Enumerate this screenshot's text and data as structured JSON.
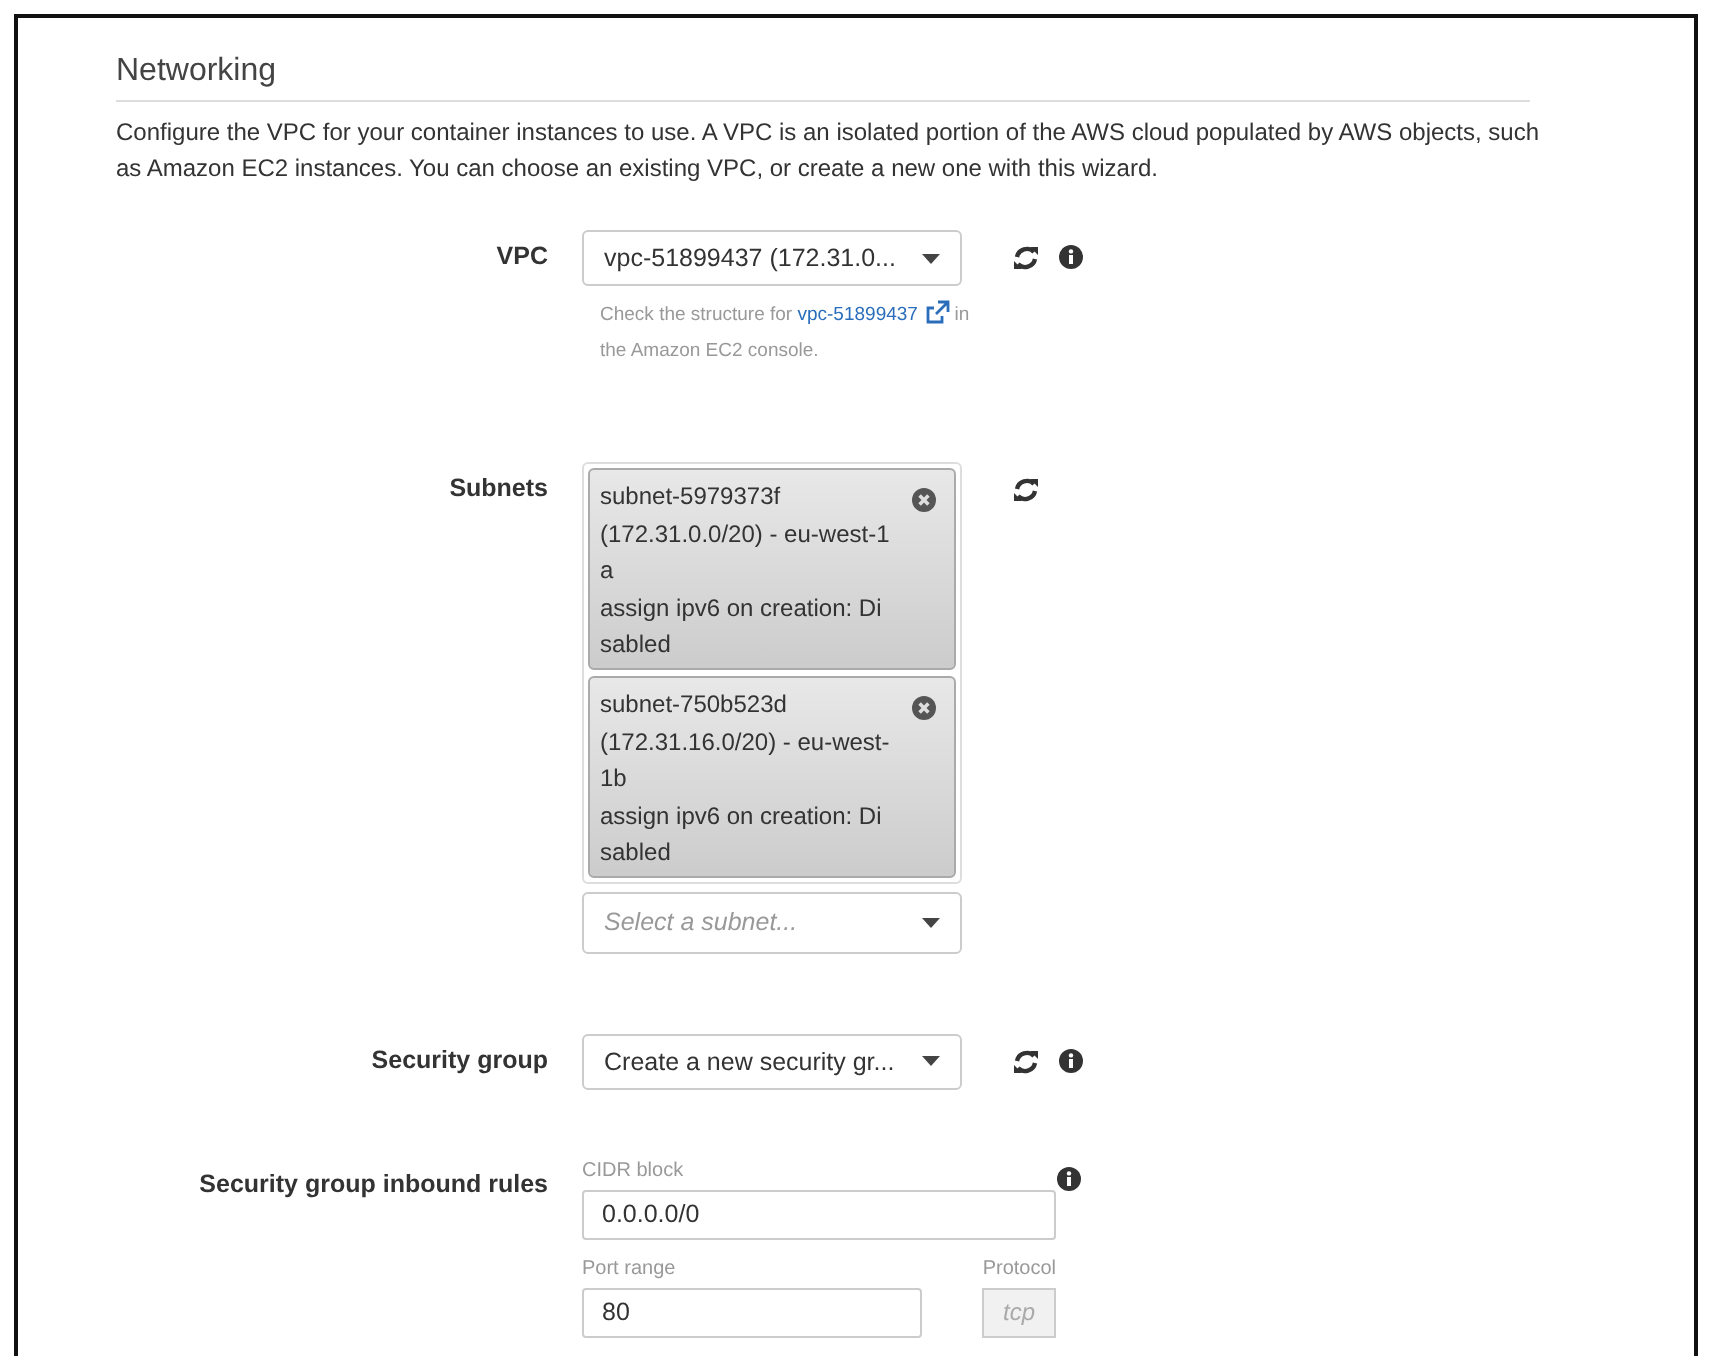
{
  "section": {
    "title": "Networking",
    "description": "Configure the VPC for your container instances to use. A VPC is an isolated portion of the AWS cloud populated by AWS objects, such as Amazon EC2 instances. You can choose an existing VPC, or create a new one with this wizard."
  },
  "vpc": {
    "label": "VPC",
    "value": "vpc-51899437 (172.31.0...",
    "help_before": "Check the structure for ",
    "help_link": "vpc-51899437",
    "help_after": " in the Amazon EC2 console."
  },
  "subnets": {
    "label": "Subnets",
    "chips": [
      {
        "text": "subnet-5979373f\n(172.31.0.0/20) - eu-west-1\na\nassign ipv6 on creation: Di\nsabled"
      },
      {
        "text": "subnet-750b523d\n(172.31.16.0/20) - eu-west-\n1b\nassign ipv6 on creation: Di\nsabled"
      }
    ],
    "placeholder": "Select a subnet..."
  },
  "security_group": {
    "label": "Security group",
    "value": "Create a new security gr..."
  },
  "inbound_rules": {
    "label": "Security group inbound rules",
    "cidr_label": "CIDR block",
    "cidr_value": "0.0.0.0/0",
    "port_label": "Port range",
    "port_value": "80",
    "protocol_label": "Protocol",
    "protocol_value": "tcp"
  }
}
